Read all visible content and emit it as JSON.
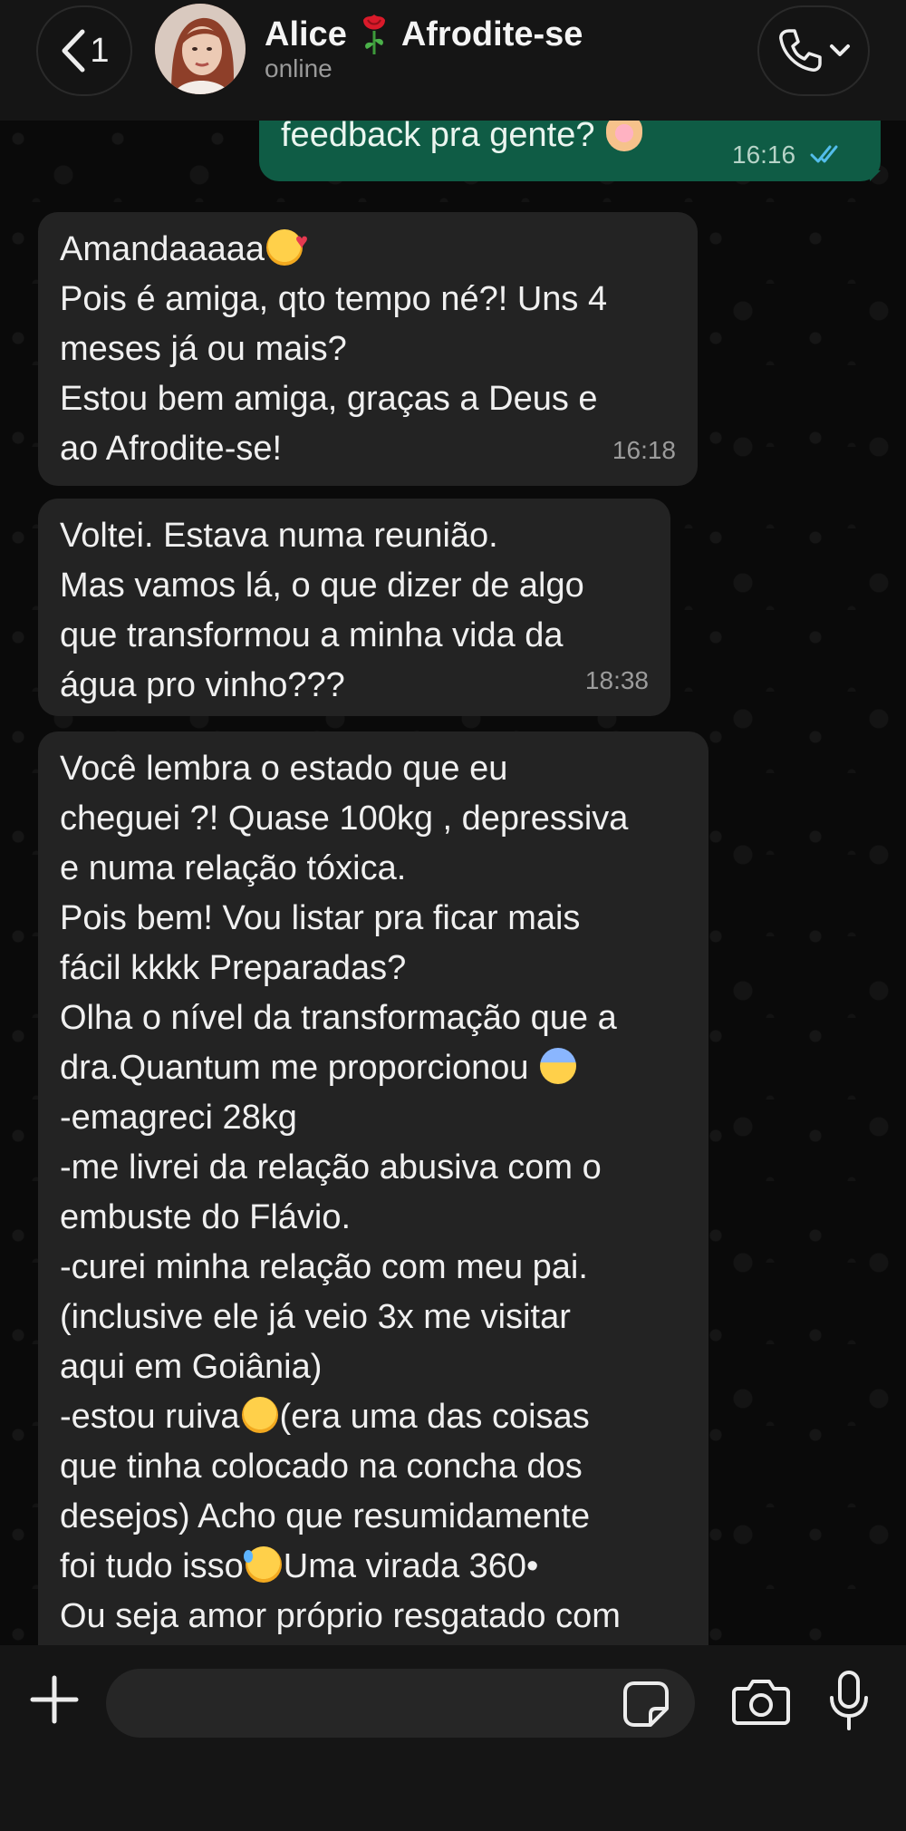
{
  "header": {
    "back_count": "1",
    "contact_name_left": "Alice",
    "contact_name_right": "Afrodite-se",
    "status": "online"
  },
  "messages": [
    {
      "direction": "outgoing",
      "text": "feedback pra gente?",
      "time": "16:16",
      "read": true
    },
    {
      "direction": "incoming",
      "lines": [
        "Amandaaaaa",
        "Pois é amiga, qto tempo né?! Uns 4",
        "meses já ou mais?",
        "Estou bem amiga, graças a Deus e",
        "ao Afrodite-se!"
      ],
      "time": "16:18"
    },
    {
      "direction": "incoming",
      "lines": [
        "Voltei. Estava  numa reunião.",
        "Mas vamos lá, o que dizer de algo",
        "que transformou a minha vida da",
        "água pro vinho???"
      ],
      "time": "18:38"
    },
    {
      "direction": "incoming",
      "lines": [
        "Você lembra o estado que eu",
        "cheguei ?! Quase 100kg , depressiva",
        "e numa relação tóxica.",
        "Pois bem! Vou listar pra ficar mais",
        "fácil kkkk Preparadas?",
        "Olha o nível da transformação que a",
        "dra.Quantum me proporcionou",
        "-emagreci 28kg",
        "-me livrei da relação abusiva com o",
        "embuste do Flávio.",
        "-curei minha relação com meu pai.",
        "(inclusive ele já veio 3x me visitar",
        "aqui em Goiânia)",
        "-estou ruiva",
        "(era uma das coisas",
        "que tinha colocado na concha dos",
        "desejos) Acho que resumidamente",
        "foi tudo isso",
        "Uma virada 360•",
        "Ou seja amor próprio resgatado com"
      ]
    }
  ],
  "composer": {
    "placeholder": ""
  },
  "colors": {
    "outgoing_bubble": "#0f5c45",
    "incoming_bubble": "#232323",
    "read_ticks": "#53bdeb"
  }
}
